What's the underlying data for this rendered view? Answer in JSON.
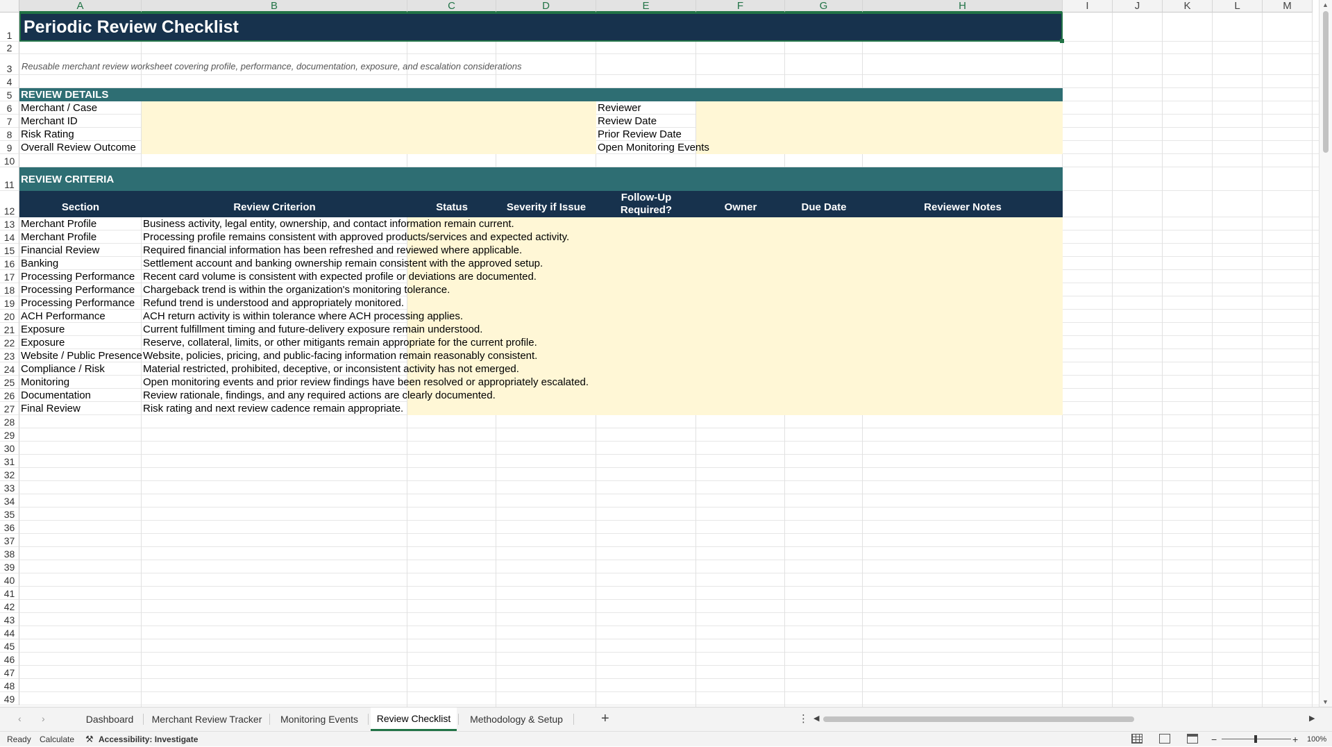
{
  "sheet": {
    "title": "Periodic Review Checklist",
    "subtitle": "Reusable merchant review worksheet covering profile, performance, documentation, exposure, and escalation considerations",
    "columns": [
      "A",
      "B",
      "C",
      "D",
      "E",
      "F",
      "G",
      "H",
      "I",
      "J",
      "K",
      "L",
      "M"
    ],
    "selected_column_range": [
      "A",
      "B",
      "C",
      "D",
      "E",
      "F",
      "G",
      "H"
    ],
    "review_details": {
      "header": "REVIEW DETAILS",
      "left_labels": [
        "Merchant / Case",
        "Merchant ID",
        "Risk Rating",
        "Overall Review Outcome"
      ],
      "right_labels": [
        "Reviewer",
        "Review Date",
        "Prior Review Date",
        "Open Monitoring Events"
      ]
    },
    "review_criteria": {
      "header": "REVIEW CRITERIA",
      "table_headers": [
        "Section",
        "Review Criterion",
        "Status",
        "Severity if Issue",
        "Follow-Up Required?",
        "Owner",
        "Due Date",
        "Reviewer Notes"
      ],
      "rows": [
        [
          "Merchant Profile",
          "Business activity, legal entity, ownership, and contact information remain current."
        ],
        [
          "Merchant Profile",
          "Processing profile remains consistent with approved products/services and expected activity."
        ],
        [
          "Financial Review",
          "Required financial information has been refreshed and reviewed where applicable."
        ],
        [
          "Banking",
          "Settlement account and banking ownership remain consistent with the approved setup."
        ],
        [
          "Processing Performance",
          "Recent card volume is consistent with expected profile or deviations are documented."
        ],
        [
          "Processing Performance",
          "Chargeback trend is within the organization's monitoring tolerance."
        ],
        [
          "Processing Performance",
          "Refund trend is understood and appropriately monitored."
        ],
        [
          "ACH Performance",
          "ACH return activity is within tolerance where ACH processing applies."
        ],
        [
          "Exposure",
          "Current fulfillment timing and future-delivery exposure remain understood."
        ],
        [
          "Exposure",
          "Reserve, collateral, limits, or other mitigants remain appropriate for the current profile."
        ],
        [
          "Website / Public Presence",
          "Website, policies, pricing, and public-facing information remain reasonably consistent."
        ],
        [
          "Compliance / Risk",
          "Material restricted, prohibited, deceptive, or inconsistent activity has not emerged."
        ],
        [
          "Monitoring",
          "Open monitoring events and prior review findings have been resolved or appropriately escalated."
        ],
        [
          "Documentation",
          "Review rationale, findings, and any required actions are clearly documented."
        ],
        [
          "Final Review",
          "Risk rating and next review cadence remain appropriate."
        ]
      ]
    }
  },
  "tabs": [
    "Dashboard",
    "Merchant Review Tracker",
    "Monitoring Events",
    "Review Checklist",
    "Methodology & Setup"
  ],
  "active_tab": "Review Checklist",
  "status": {
    "ready": "Ready",
    "calculate": "Calculate",
    "accessibility": "Accessibility: Investigate",
    "zoom": "100%"
  },
  "colors": {
    "title_bg": "#17324d",
    "section_bg": "#2e6e73",
    "header_bg": "#17324d",
    "input_bg": "#fff7d6",
    "accent": "#217346"
  }
}
